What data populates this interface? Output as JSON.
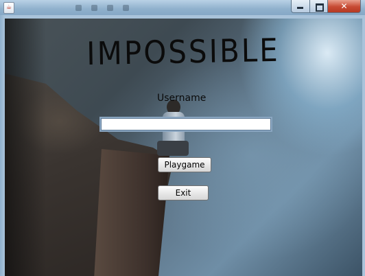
{
  "window": {
    "app_icon_glyph": "☕",
    "controls": {
      "minimize": "",
      "maximize": "",
      "close": "✕"
    }
  },
  "game": {
    "title": "IMPOSSIBLE"
  },
  "login": {
    "username_label": "Username",
    "username_value": "",
    "playgame_label": "Playgame",
    "exit_label": "Exit"
  },
  "colors": {
    "title_bar": "#8fb0cc",
    "close_button": "#c74a33",
    "input_border": "#8aa6c1"
  }
}
